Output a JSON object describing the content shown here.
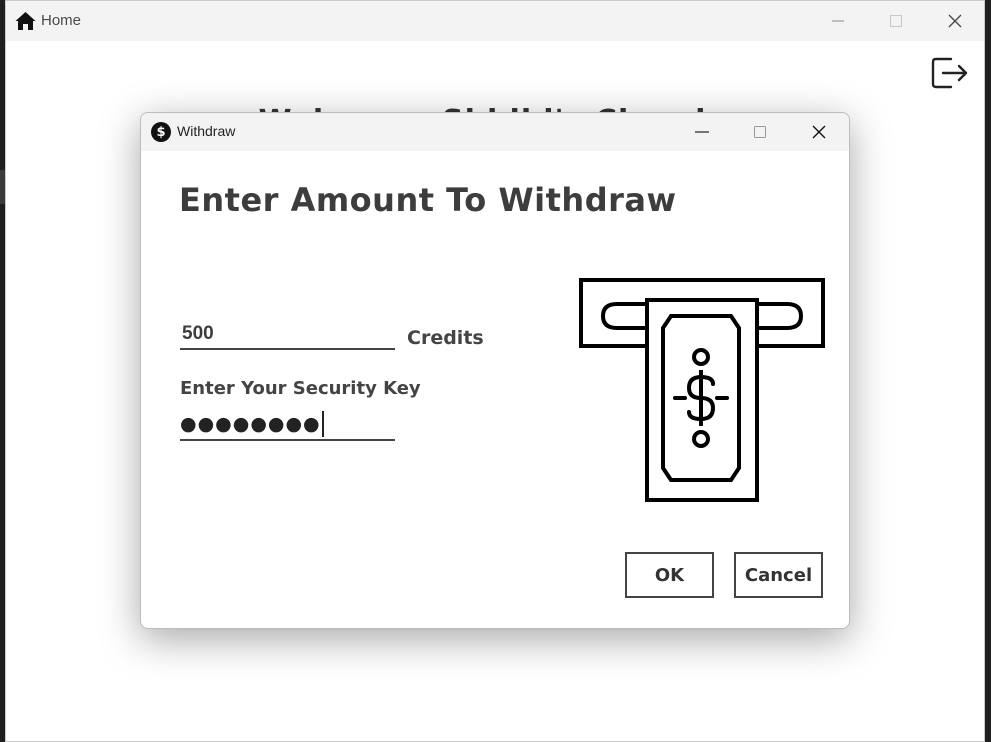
{
  "main_window": {
    "title": "Home",
    "background_heading": "Welcome, Siddhi's Chandra",
    "icons": {
      "home": "home-icon",
      "logout": "logout-icon"
    }
  },
  "dialog": {
    "title": "Withdraw",
    "icon": "dollar-circle-icon",
    "heading": "Enter Amount To Withdraw",
    "amount_value": "500",
    "credits_label": "Credits",
    "security_key_label": "Enter Your Security Key",
    "security_key_masked": "●●●●●●●●",
    "ok_label": "OK",
    "cancel_label": "Cancel",
    "illustration": "atm-cash-icon"
  }
}
